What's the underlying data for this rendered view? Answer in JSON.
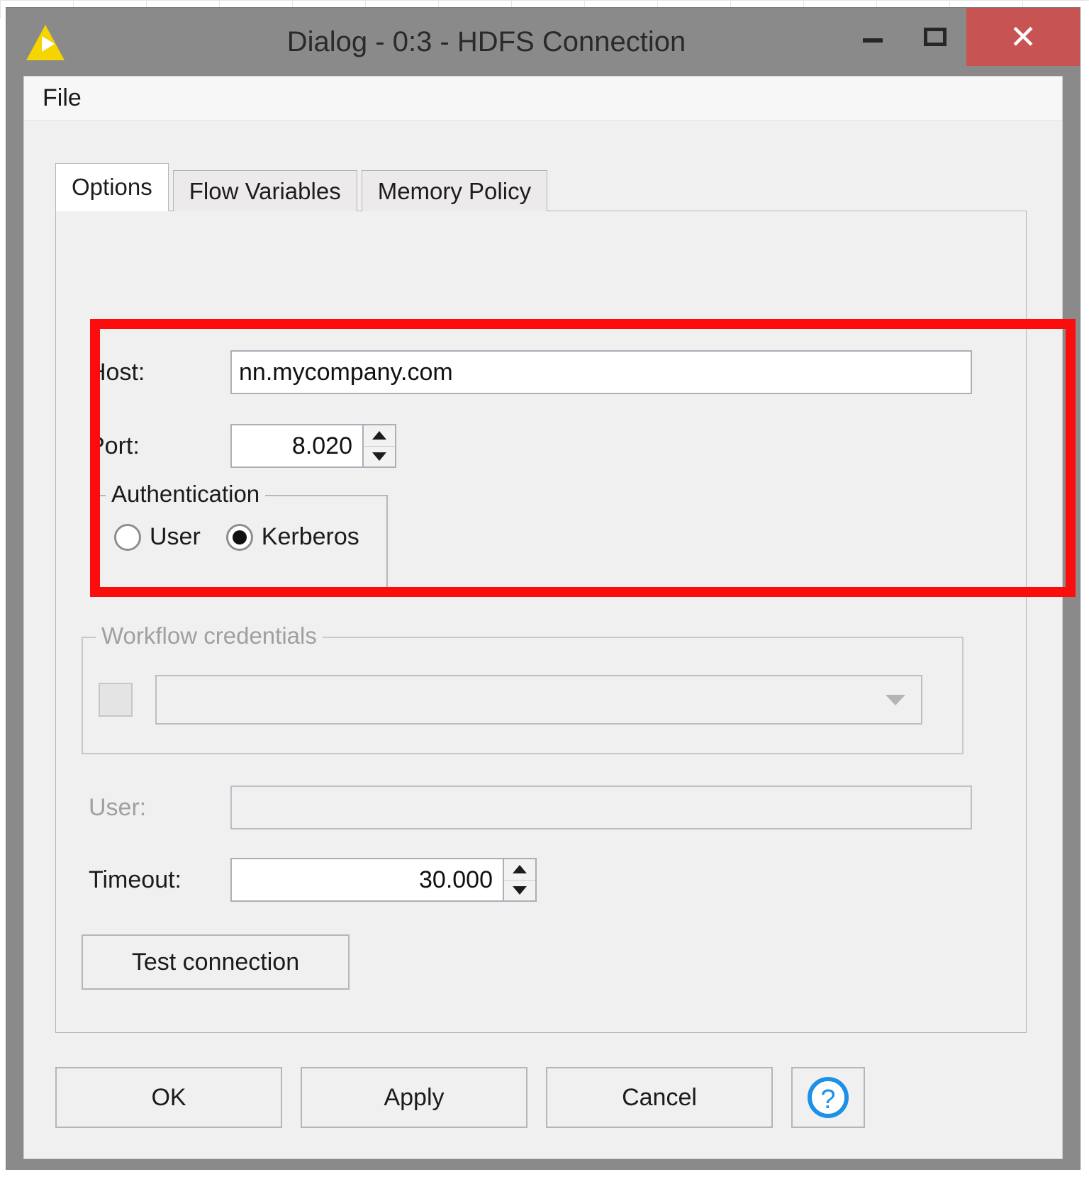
{
  "window": {
    "title": "Dialog - 0:3 - HDFS Connection",
    "app_icon": "knime-triangle-icon",
    "controls": {
      "minimize": "minimize-icon",
      "maximize": "maximize-icon",
      "close": "close-icon"
    },
    "close_button_color": "#c75353",
    "titlebar_color": "#8a8a8a"
  },
  "menubar": {
    "items": [
      {
        "label": "File"
      }
    ]
  },
  "tabs": [
    {
      "label": "Options",
      "selected": true
    },
    {
      "label": "Flow Variables",
      "selected": false
    },
    {
      "label": "Memory Policy",
      "selected": false
    }
  ],
  "annotation": {
    "highlight_color": "#fc0d0d",
    "shape": "rectangle"
  },
  "options": {
    "host": {
      "label": "Host:",
      "value": "nn.mycompany.com",
      "placeholder": "",
      "enabled": true
    },
    "port": {
      "label": "Port:",
      "value": "8.020",
      "enabled": true,
      "spinner": true
    },
    "authentication": {
      "group_label": "Authentication",
      "enabled": true,
      "options": [
        {
          "label": "User",
          "selected": false
        },
        {
          "label": "Kerberos",
          "selected": true
        }
      ]
    },
    "workflow_credentials": {
      "group_label": "Workflow credentials",
      "enabled": false,
      "checkbox_checked": false,
      "dropdown_value": "",
      "dropdown_icon": "chevron-down-icon"
    },
    "user": {
      "label": "User:",
      "value": "",
      "enabled": false
    },
    "timeout": {
      "label": "Timeout:",
      "value": "30.000",
      "enabled": true,
      "spinner": true
    },
    "test_connection": {
      "label": "Test connection"
    }
  },
  "footer": {
    "ok_label": "OK",
    "apply_label": "Apply",
    "cancel_label": "Cancel",
    "help_icon": "help-question-icon",
    "help_color": "#1e90e8"
  }
}
